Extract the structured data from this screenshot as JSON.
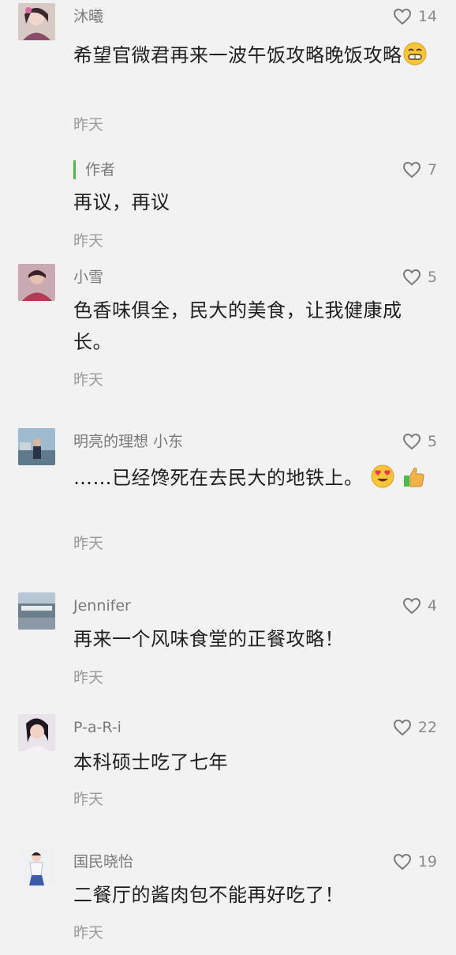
{
  "comments": [
    {
      "name": "沐曦",
      "likes": "14",
      "text": "希望官微君再来一波午饭攻略晚饭攻略",
      "time": "昨天"
    },
    {
      "name": "作者",
      "likes": "7",
      "text": "再议，再议",
      "time": "昨天"
    },
    {
      "name": "小雪",
      "likes": "5",
      "text": "色香味俱全，民大的美食，让我健康成长。",
      "time": "昨天"
    },
    {
      "name": "明亮的理想 小东",
      "likes": "5",
      "text": "……已经馋死在去民大的地铁上。",
      "time": "昨天"
    },
    {
      "name": "Jennifer",
      "likes": "4",
      "text": "再来一个风味食堂的正餐攻略！",
      "time": "昨天"
    },
    {
      "name": "P-a-R-i",
      "likes": "22",
      "text": "本科硕士吃了七年",
      "time": "昨天"
    },
    {
      "name": "国民晓怡",
      "likes": "19",
      "text": "二餐厅的酱肉包不能再好吃了！",
      "time": "昨天"
    }
  ],
  "colors": {
    "background": "#f2f2f2",
    "author_accent": "#4fb84a",
    "name": "#7a7a7a",
    "text": "#1f1f1f",
    "time": "#9a9a9a"
  },
  "icons": [
    "heart-outline-icon",
    "grin-emoji-icon",
    "heart-eyes-emoji-icon",
    "thumbs-up-emoji-icon"
  ]
}
